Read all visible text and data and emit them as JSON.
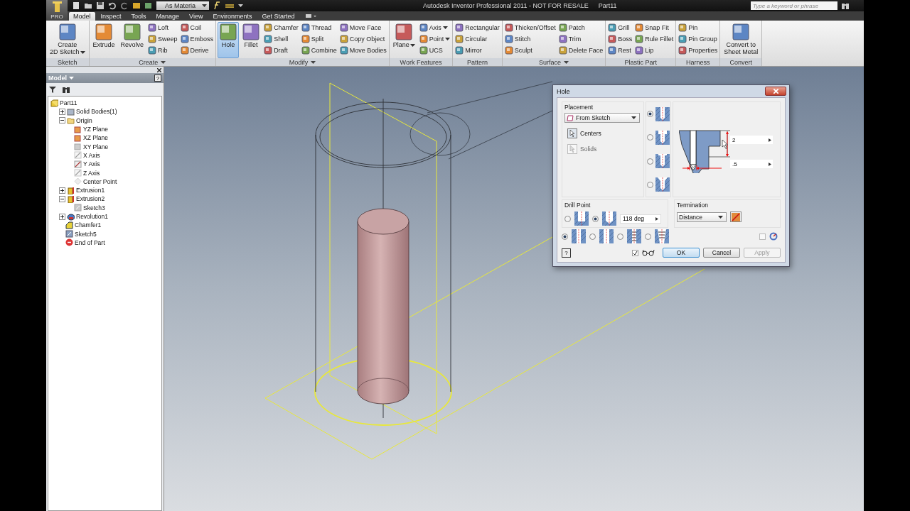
{
  "title_bar": {
    "app_badge": "PRO",
    "style_dropdown": "As Materia",
    "title": "Autodesk Inventor Professional 2011 - NOT FOR RESALE",
    "document": "Part11",
    "search_placeholder": "Type a keyword or phrase"
  },
  "tabs": [
    {
      "label": "Model",
      "selected": true
    },
    {
      "label": "Inspect",
      "selected": false
    },
    {
      "label": "Tools",
      "selected": false
    },
    {
      "label": "Manage",
      "selected": false
    },
    {
      "label": "View",
      "selected": false
    },
    {
      "label": "Environments",
      "selected": false
    },
    {
      "label": "Get Started",
      "selected": false
    }
  ],
  "ribbon": {
    "panels": [
      {
        "label": "Sketch",
        "menu": false,
        "tools": [
          {
            "kind": "large",
            "label": "Create\n2D Sketch",
            "selected": false,
            "dropdown": true
          }
        ]
      },
      {
        "label": "Create",
        "menu": true,
        "tools": [
          {
            "kind": "large",
            "label": "Extrude",
            "selected": false,
            "dropdown": false
          },
          {
            "kind": "large",
            "label": "Revolve",
            "selected": false,
            "dropdown": false
          },
          {
            "kind": "column",
            "items": [
              {
                "label": "Loft",
                "dropdown": false
              },
              {
                "label": "Sweep",
                "dropdown": false
              },
              {
                "label": "Rib",
                "dropdown": false
              }
            ]
          },
          {
            "kind": "column",
            "items": [
              {
                "label": "Coil",
                "dropdown": false
              },
              {
                "label": "Emboss",
                "dropdown": false
              },
              {
                "label": "Derive",
                "dropdown": false
              }
            ]
          }
        ]
      },
      {
        "label": "Modify",
        "menu": true,
        "tools": [
          {
            "kind": "large",
            "label": "Hole",
            "selected": true,
            "dropdown": false
          },
          {
            "kind": "large",
            "label": "Fillet",
            "selected": false,
            "dropdown": false
          },
          {
            "kind": "column",
            "items": [
              {
                "label": "Chamfer",
                "dropdown": false
              },
              {
                "label": "Shell",
                "dropdown": false
              },
              {
                "label": "Draft",
                "dropdown": false
              }
            ]
          },
          {
            "kind": "column",
            "items": [
              {
                "label": "Thread",
                "dropdown": false
              },
              {
                "label": "Split",
                "dropdown": false
              },
              {
                "label": "Combine",
                "dropdown": false
              }
            ]
          },
          {
            "kind": "column",
            "items": [
              {
                "label": "Move Face",
                "dropdown": false
              },
              {
                "label": "Copy Object",
                "dropdown": false
              },
              {
                "label": "Move Bodies",
                "dropdown": false
              }
            ]
          }
        ]
      },
      {
        "label": "Work Features",
        "menu": false,
        "tools": [
          {
            "kind": "large",
            "label": "Plane",
            "selected": false,
            "dropdown": true
          },
          {
            "kind": "column",
            "items": [
              {
                "label": "Axis",
                "dropdown": true
              },
              {
                "label": "Point",
                "dropdown": true
              },
              {
                "label": "UCS",
                "dropdown": false
              }
            ]
          }
        ]
      },
      {
        "label": "Pattern",
        "menu": false,
        "tools": [
          {
            "kind": "column",
            "items": [
              {
                "label": "Rectangular",
                "dropdown": false
              },
              {
                "label": "Circular",
                "dropdown": false
              },
              {
                "label": "Mirror",
                "dropdown": false
              }
            ]
          }
        ]
      },
      {
        "label": "Surface",
        "menu": true,
        "tools": [
          {
            "kind": "column",
            "items": [
              {
                "label": "Thicken/Offset",
                "dropdown": false
              },
              {
                "label": "Stitch",
                "dropdown": false
              },
              {
                "label": "Sculpt",
                "dropdown": false
              }
            ]
          },
          {
            "kind": "column",
            "items": [
              {
                "label": "Patch",
                "dropdown": false
              },
              {
                "label": "Trim",
                "dropdown": false
              },
              {
                "label": "Delete Face",
                "dropdown": false
              }
            ]
          }
        ]
      },
      {
        "label": "Plastic Part",
        "menu": false,
        "tools": [
          {
            "kind": "column",
            "items": [
              {
                "label": "Grill",
                "dropdown": false
              },
              {
                "label": "Boss",
                "dropdown": false
              },
              {
                "label": "Rest",
                "dropdown": false
              }
            ]
          },
          {
            "kind": "column",
            "items": [
              {
                "label": "Snap Fit",
                "dropdown": false
              },
              {
                "label": "Rule Fillet",
                "dropdown": false
              },
              {
                "label": "Lip",
                "dropdown": false
              }
            ]
          }
        ]
      },
      {
        "label": "Harness",
        "menu": false,
        "tools": [
          {
            "kind": "column",
            "items": [
              {
                "label": "Pin",
                "dropdown": false
              },
              {
                "label": "Pin Group",
                "dropdown": false
              },
              {
                "label": "Properties",
                "dropdown": false
              }
            ]
          }
        ]
      },
      {
        "label": "Convert",
        "menu": false,
        "tools": [
          {
            "kind": "large",
            "label": "Convert to\nSheet Metal",
            "selected": false,
            "dropdown": false
          }
        ]
      }
    ]
  },
  "browser": {
    "title": "Model",
    "help": "?",
    "tree": [
      {
        "label": "Part11",
        "kind": "part",
        "children": [
          {
            "label": "Solid Bodies(1)",
            "kind": "bodies",
            "visible": true,
            "expanded": false
          },
          {
            "label": "Origin",
            "kind": "folder",
            "visible": true,
            "expanded": true,
            "children": [
              {
                "label": "YZ Plane",
                "kind": "plane",
                "visible": true
              },
              {
                "label": "XZ Plane",
                "kind": "plane",
                "visible": true
              },
              {
                "label": "XY Plane",
                "kind": "plane",
                "visible": false
              },
              {
                "label": "X Axis",
                "kind": "axis",
                "visible": false
              },
              {
                "label": "Y Axis",
                "kind": "axis",
                "visible": true
              },
              {
                "label": "Z Axis",
                "kind": "axis",
                "visible": false
              },
              {
                "label": "Center Point",
                "kind": "point",
                "visible": false
              }
            ]
          },
          {
            "label": "Extrusion1",
            "kind": "extrusion",
            "visible": true,
            "expanded": false
          },
          {
            "label": "Extrusion2",
            "kind": "extrusion",
            "visible": true,
            "expanded": true,
            "children": [
              {
                "label": "Sketch3",
                "kind": "sketch",
                "visible": false
              }
            ]
          },
          {
            "label": "Revolution1",
            "kind": "revolution",
            "visible": true,
            "expanded": false
          },
          {
            "label": "Chamfer1",
            "kind": "chamfer",
            "visible": true
          },
          {
            "label": "Sketch5",
            "kind": "sketch",
            "visible": true
          },
          {
            "label": "End of Part",
            "kind": "end",
            "visible": true
          }
        ]
      }
    ]
  },
  "hole_dialog": {
    "title": "Hole",
    "placement_label": "Placement",
    "placement": "From Sketch",
    "selectors": [
      {
        "label": "Centers",
        "selected": true,
        "disabled": false
      },
      {
        "label": "Solids",
        "selected": false,
        "disabled": true
      }
    ],
    "hole_types": [
      {
        "kind": "drilled",
        "selected": true
      },
      {
        "kind": "counterbore",
        "selected": false
      },
      {
        "kind": "spotface",
        "selected": false
      },
      {
        "kind": "countersink",
        "selected": false
      }
    ],
    "depth": "2",
    "diameter": ".5",
    "drill_point_label": "Drill Point",
    "drill_points": [
      {
        "kind": "flat",
        "selected": false
      },
      {
        "kind": "angle",
        "selected": true
      }
    ],
    "drill_angle": "118 deg",
    "termination_label": "Termination",
    "termination": "Distance",
    "thread_types": [
      {
        "kind": "simple",
        "selected": true
      },
      {
        "kind": "clearance",
        "selected": false
      },
      {
        "kind": "tapped",
        "selected": false
      },
      {
        "kind": "taper",
        "selected": false
      }
    ],
    "ipart_checked": false,
    "help": "?",
    "preview_checked": true,
    "buttons": [
      {
        "label": "OK",
        "default": true,
        "disabled": false
      },
      {
        "label": "Cancel",
        "default": false,
        "disabled": false
      },
      {
        "label": "Apply",
        "default": false,
        "disabled": true
      }
    ]
  }
}
